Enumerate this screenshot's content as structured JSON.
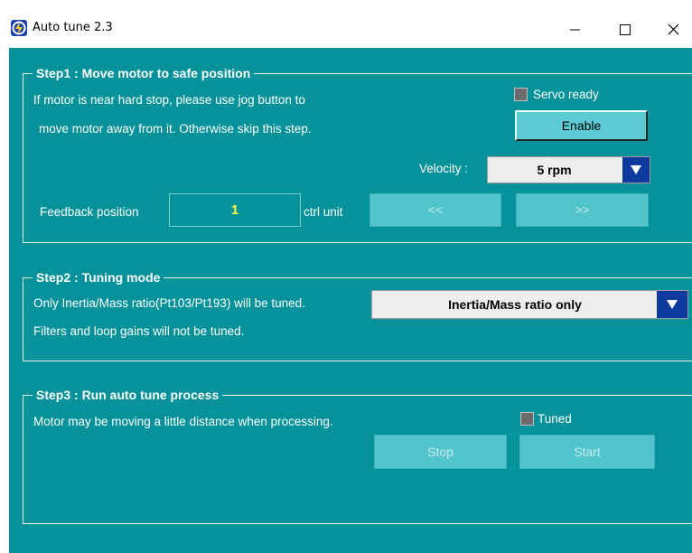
{
  "window": {
    "title": "Auto tune 2.3",
    "background_color": "#05929a",
    "controls": {
      "minimize_icon": "minimize-icon",
      "maximize_icon": "maximize-icon",
      "close_icon": "close-icon"
    }
  },
  "step1": {
    "title": "Step1 : Move motor to safe position",
    "line1": "If motor is near hard stop, please use jog button to",
    "line2": "move motor away from it. Otherwise skip this step.",
    "servo_ready_label": "Servo ready",
    "servo_ready_checked": false,
    "enable_label": "Enable",
    "velocity_label": "Velocity :",
    "velocity_value": "5 rpm",
    "feedback_label": "Feedback position",
    "feedback_value": "1",
    "unit_label": "ctrl unit",
    "jog_back_label": "<<",
    "jog_forward_label": ">>"
  },
  "step2": {
    "title": "Step2 : Tuning mode",
    "line1": "Only Inertia/Mass ratio(Pt103/Pt193) will be tuned.",
    "line2": "Filters and loop gains will not be tuned.",
    "mode_value": "Inertia/Mass ratio only"
  },
  "step3": {
    "title": "Step3 : Run auto tune process",
    "line1": "Motor may be moving a little distance when processing.",
    "tuned_label": "Tuned",
    "tuned_checked": false,
    "stop_label": "Stop",
    "start_label": "Start"
  }
}
